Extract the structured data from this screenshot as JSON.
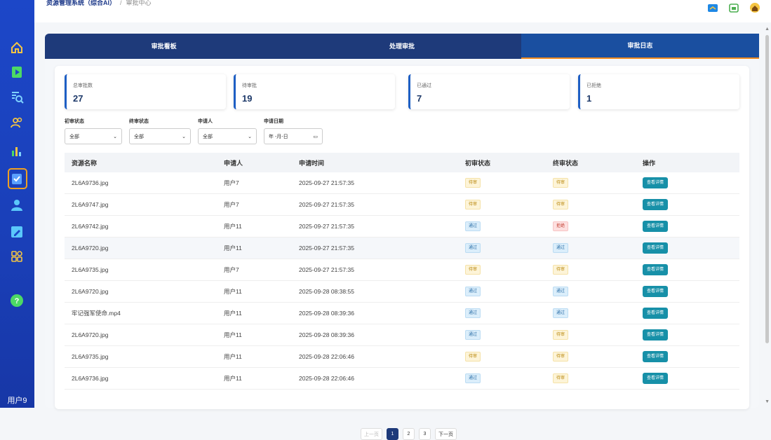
{
  "breadcrumb": {
    "root": "资源管理系统（综合AI）",
    "separator": "/",
    "current": "审批中心"
  },
  "sidebar": {
    "icons": [
      "home-icon",
      "play-icon",
      "search-list-icon",
      "users-icon",
      "chart-icon",
      "approval-icon",
      "user-icon",
      "edit-icon",
      "apps-icon",
      "help-icon"
    ],
    "user_label": "用户9"
  },
  "tabs": [
    {
      "label": "审批看板"
    },
    {
      "label": "处理审批"
    },
    {
      "label": "审批日志"
    }
  ],
  "stats": [
    {
      "label": "总审批数",
      "value": "27"
    },
    {
      "label": "待审批",
      "value": "19"
    },
    {
      "label": "已通过",
      "value": "7"
    },
    {
      "label": "已拒绝",
      "value": "1"
    }
  ],
  "filters": {
    "first_status": {
      "label": "初审状态",
      "value": "全部"
    },
    "final_status": {
      "label": "终审状态",
      "value": "全部"
    },
    "applicant": {
      "label": "申请人",
      "value": "全部"
    },
    "date": {
      "label": "申请日期",
      "value": "年 -月-日"
    }
  },
  "table": {
    "headers": [
      "资源名称",
      "申请人",
      "申请时间",
      "初审状态",
      "终审状态",
      "操作"
    ],
    "action_label": "查看详情",
    "rows": [
      {
        "name": "2L6A9736.jpg",
        "applicant": "用户7",
        "time": "2025-09-27 21:57:35",
        "first": "待审",
        "final": "待审"
      },
      {
        "name": "2L6A9747.jpg",
        "applicant": "用户7",
        "time": "2025-09-27 21:57:35",
        "first": "待审",
        "final": "待审"
      },
      {
        "name": "2L6A9742.jpg",
        "applicant": "用户11",
        "time": "2025-09-27 21:57:35",
        "first": "通过",
        "final": "拒绝"
      },
      {
        "name": "2L6A9720.jpg",
        "applicant": "用户11",
        "time": "2025-09-27 21:57:35",
        "first": "通过",
        "final": "通过"
      },
      {
        "name": "2L6A9735.jpg",
        "applicant": "用户7",
        "time": "2025-09-27 21:57:35",
        "first": "待审",
        "final": "待审"
      },
      {
        "name": "2L6A9720.jpg",
        "applicant": "用户11",
        "time": "2025-09-28 08:38:55",
        "first": "通过",
        "final": "通过"
      },
      {
        "name": "牢记强军使命.mp4",
        "applicant": "用户11",
        "time": "2025-09-28 08:39:36",
        "first": "通过",
        "final": "通过"
      },
      {
        "name": "2L6A9720.jpg",
        "applicant": "用户11",
        "time": "2025-09-28 08:39:36",
        "first": "通过",
        "final": "待审"
      },
      {
        "name": "2L6A9735.jpg",
        "applicant": "用户11",
        "time": "2025-09-28 22:06:46",
        "first": "待审",
        "final": "待审"
      },
      {
        "name": "2L6A9736.jpg",
        "applicant": "用户11",
        "time": "2025-09-28 22:06:46",
        "first": "通过",
        "final": "待审"
      }
    ]
  },
  "pagination": {
    "prev": "上一页",
    "pages": [
      "1",
      "2",
      "3"
    ],
    "current": "1",
    "next": "下一页"
  },
  "colors": {
    "sidebar": "#1c47c8",
    "tab_bar": "#1e3a7a",
    "accent": "#f08a1e",
    "action": "#1790a8"
  }
}
